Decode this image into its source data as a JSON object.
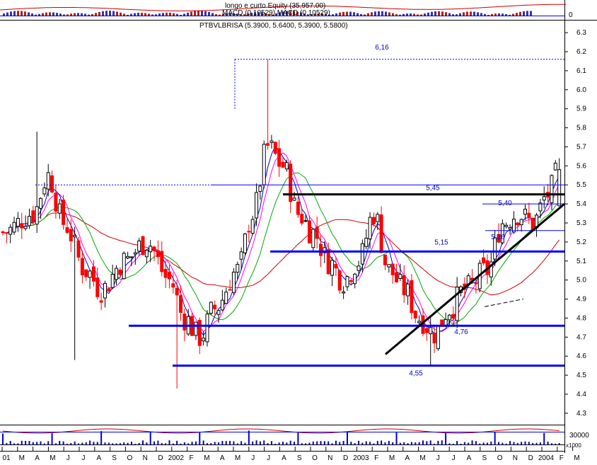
{
  "indicators": {
    "macd_legend_1": "longo e curto Equity (35,957.00)",
    "macd_legend_2": "MACD (0.10529) MACD (0.10529)",
    "macd_zero": "0"
  },
  "main_legend": "PTBVLBRISA (5.3900, 5.6400, 5.3900, 5.5800)",
  "volume": {
    "scale_label": "30000",
    "scale_unit": "x1000"
  },
  "colors": {
    "up": "#000000",
    "down": "#ff0000",
    "ma_fast": "#0000cc",
    "ma_pink": "#ff00ff",
    "ma_mid": "#00aa00",
    "ma_slow": "#cc0000",
    "level_line": "#0000ff",
    "trend_line": "#000000",
    "annot_text": "#0000cc"
  },
  "chart_data": {
    "type": "candlestick",
    "title": "PTBVLBRISA (5.3900, 5.6400, 5.3900, 5.5800)",
    "ylim": [
      4.2,
      6.4
    ],
    "y_ticks": [
      "4.3",
      "4.4",
      "4.5",
      "4.6",
      "4.7",
      "4.8",
      "4.9",
      "5.0",
      "5.1",
      "5.2",
      "5.3",
      "5.4",
      "5.5",
      "5.6",
      "5.7",
      "5.8",
      "5.9",
      "6.0",
      "6.1",
      "6.2",
      "6.3"
    ],
    "x_ticks": [
      "01",
      "M",
      "A",
      "M",
      "J",
      "J",
      "A",
      "S",
      "O",
      "N",
      "D",
      "2002",
      "F",
      "M",
      "A",
      "M",
      "J",
      "J",
      "A",
      "S",
      "O",
      "N",
      "D",
      "2003",
      "F",
      "M",
      "A",
      "M",
      "J",
      "J",
      "A",
      "S",
      "O",
      "N",
      "D",
      "2004",
      "F",
      "M"
    ],
    "last_close": 5.58,
    "annotations": [
      {
        "label": "6,16",
        "value": 6.16
      },
      {
        "label": "5,45",
        "value": 5.45
      },
      {
        "label": "5,40",
        "value": 5.4
      },
      {
        "label": "5,26",
        "value": 5.26
      },
      {
        "label": "5,15",
        "value": 5.15
      },
      {
        "label": "4,76",
        "value": 4.76
      },
      {
        "label": "4,55",
        "value": 4.55
      }
    ],
    "grid": false,
    "legend": "top-left"
  }
}
